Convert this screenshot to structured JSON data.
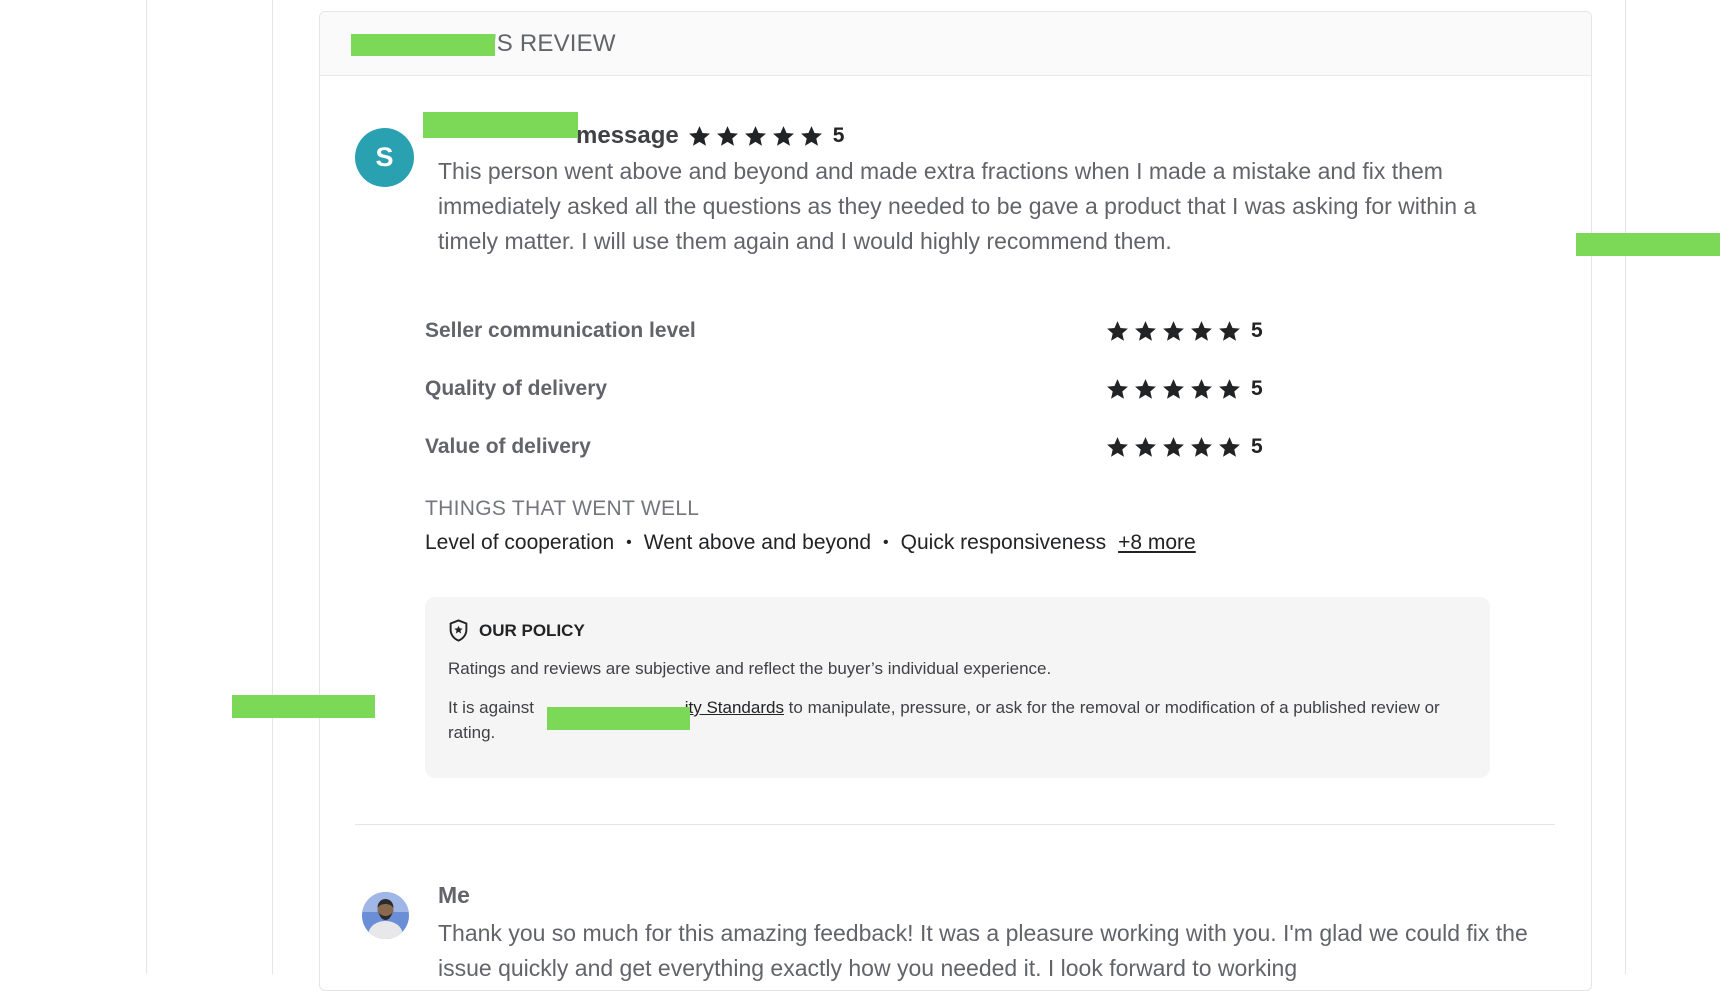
{
  "colors": {
    "accent_avatar": "#2aa1b1",
    "star": "#222325",
    "redaction": "#7bd957",
    "policy_bg": "#f5f5f5"
  },
  "header": {
    "title_suffix": "'S REVIEW"
  },
  "review": {
    "avatar_letter": "S",
    "name_suffix": "message",
    "rating": "5",
    "rating_value": 5,
    "text": "This person went above and beyond and made extra fractions when I made a mistake and fix them immediately asked all the questions as they needed to be gave a product that I was asking for within a timely matter. I will use them again and I would highly recommend them."
  },
  "ratings": [
    {
      "label": "Seller communication level",
      "score": "5",
      "value": 5
    },
    {
      "label": "Quality of delivery",
      "score": "5",
      "value": 5
    },
    {
      "label": "Value of delivery",
      "score": "5",
      "value": 5
    }
  ],
  "well": {
    "title": "THINGS THAT WENT WELL",
    "items": [
      "Level of cooperation",
      "Went above and beyond",
      "Quick responsiveness"
    ],
    "separator": "•",
    "more": "+8 more"
  },
  "policy": {
    "icon": "shield-star-icon",
    "title": "OUR POLICY",
    "line1": "Ratings and reviews are subjective and reflect the buyer’s individual experience.",
    "line2_prefix": "It is against ",
    "line2_link": "ity Standards",
    "line2_suffix": " to manipulate, pressure, or ask for the removal or modification of a published review or rating."
  },
  "reply": {
    "avatar": "user-photo-avatar",
    "name": "Me",
    "text": "Thank you so much for this amazing feedback! It was a pleasure working with you. I'm glad we could fix the issue quickly and get everything exactly how you needed it. I look forward to working"
  }
}
